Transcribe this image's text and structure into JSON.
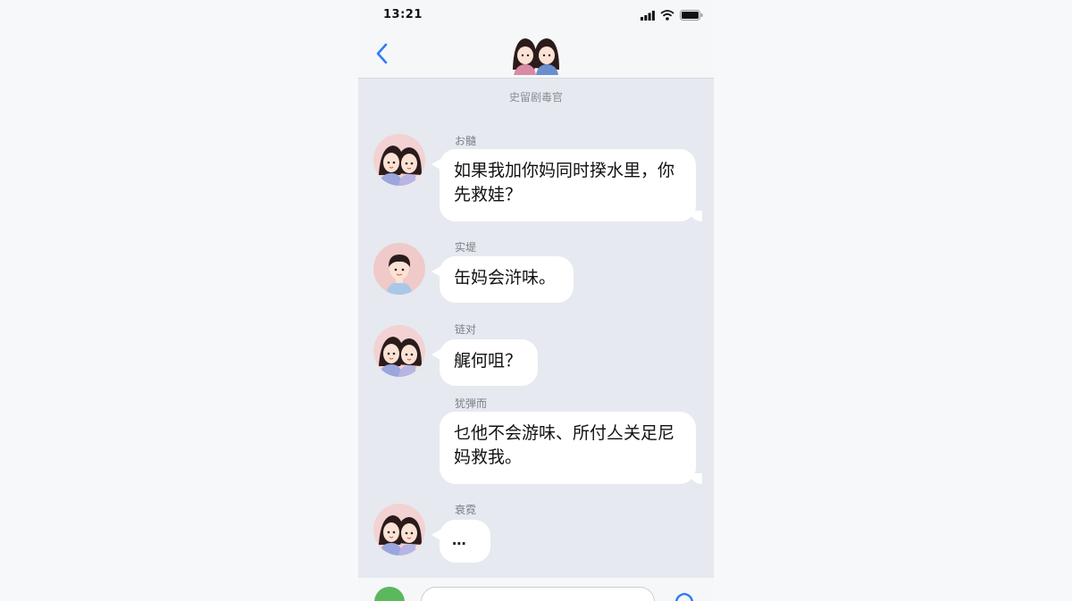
{
  "status_bar": {
    "time": "13:21"
  },
  "header": {
    "back_icon": "chevron-left-icon",
    "avatar": "couple-avatar"
  },
  "chat": {
    "date_label": "史留剧毒官",
    "messages": [
      {
        "sender": "女生",
        "name": "お髓",
        "avatar": "girl-couple-avatar",
        "text": "如果我加你妈同时揆水里，你先救娃？"
      },
      {
        "sender": "男生",
        "name": "实堤",
        "avatar": "boy-avatar",
        "text": "缶妈会浒味。"
      },
      {
        "sender": "女生",
        "name": "链对",
        "avatar": "girl-couple-avatar",
        "text": "艉何咀？"
      },
      {
        "sender": "女生",
        "name": "犹弾而",
        "avatar": "",
        "text": "乜他不会游味、所付亼关足尼妈救我。"
      },
      {
        "sender": "女生",
        "name": "衰霓",
        "avatar": "girl-couple-avatar",
        "text": "..."
      }
    ]
  },
  "input_bar": {
    "plus_icon": "plus-icon",
    "mic_icon": "voice-icon",
    "placeholder": ""
  },
  "colors": {
    "background": "#e6e9ef",
    "bubble": "#ffffff",
    "accent": "#2f7cf6",
    "plus": "#5cb85c"
  }
}
